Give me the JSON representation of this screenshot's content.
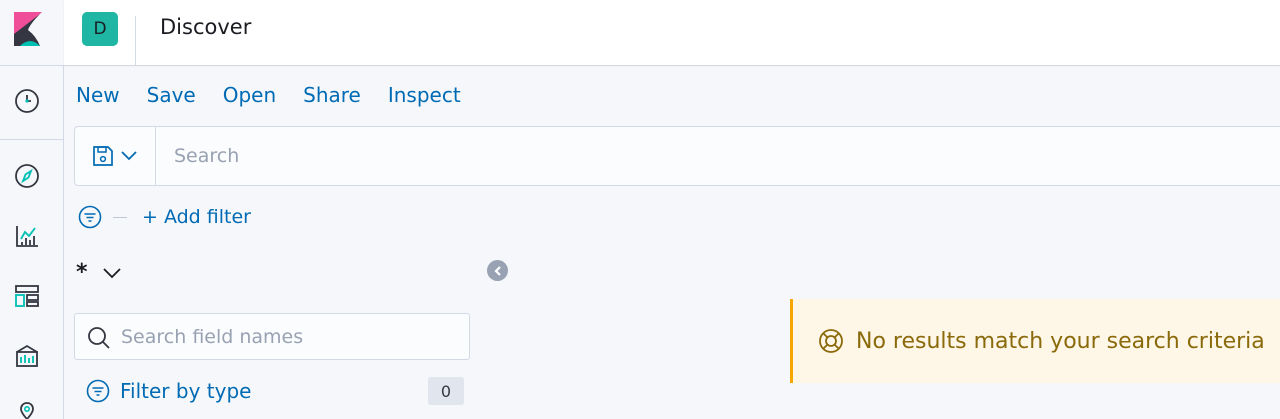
{
  "header": {
    "space_initial": "D",
    "page_title": "Discover"
  },
  "nav": {
    "icons": [
      "clock-icon",
      "compass-icon",
      "visualize-icon",
      "dashboard-icon",
      "canvas-icon",
      "maps-icon"
    ]
  },
  "topmenu": {
    "items": [
      "New",
      "Save",
      "Open",
      "Share",
      "Inspect"
    ]
  },
  "search": {
    "placeholder": "Search"
  },
  "filters": {
    "add_filter_label": "+ Add filter"
  },
  "sidebar": {
    "index_pattern": "*",
    "field_search_placeholder": "Search field names",
    "filter_by_type_label": "Filter by type",
    "filter_count": "0"
  },
  "results": {
    "callout_text": "No results match your search criteria"
  },
  "colors": {
    "link": "#006bb4",
    "space_avatar": "#1fb6a4",
    "warning_border": "#f5a700",
    "warning_bg": "#fef6e6"
  }
}
